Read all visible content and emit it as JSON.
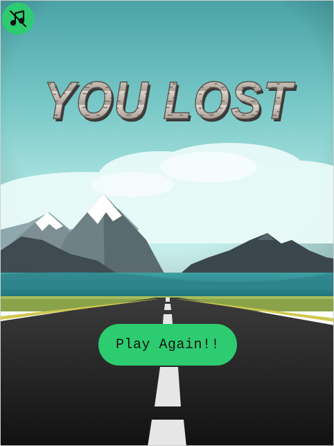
{
  "game": {
    "title_text": "YOU LOST",
    "play_again_label": "Play Again!!"
  },
  "icons": {
    "mute_button": "music-note-muted-icon"
  },
  "colors": {
    "accent_green": "#2ecc71",
    "sky_top": "#5fb8b8",
    "sky_bottom": "#9fe0de",
    "road": "#2a2a2a",
    "title_stone": "#cfc6bd"
  }
}
